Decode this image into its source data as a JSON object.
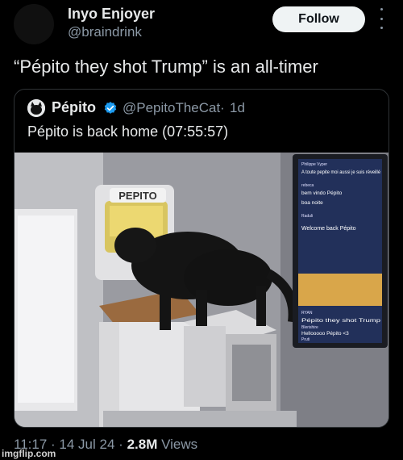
{
  "tweet": {
    "author_name": "Inyo Enjoyer",
    "author_handle": "@braindrink",
    "follow_label": "Follow",
    "text": "“Pépito they shot Trump” is an all-timer",
    "timestamp": "11:17",
    "date": "14 Jul 24",
    "views_count": "2.8M",
    "views_label": "Views",
    "separator": "·"
  },
  "quoted": {
    "author_name": "Pépito",
    "author_handle": "@PepitoTheCat",
    "age": "1d",
    "text": "Pépito is back home (07:55:57)",
    "media": {
      "flap_label": "PEPITO",
      "screen_chat": [
        {
          "user": "Philippe Vyper",
          "message": "A toute pepite moi aussi je suis réveillé"
        },
        {
          "user": "rebeca",
          "message": "bem vindo Pépito"
        },
        {
          "user": "",
          "message": "boa noite"
        },
        {
          "user": "Raduli",
          "message": "Welcome back Pépito"
        },
        {
          "user": "RYAN",
          "message": "Pépito they shot Trump"
        },
        {
          "user": "Blerishire",
          "message": "Hellooooo Pépito <3"
        },
        {
          "user": "Pruti",
          "message": ""
        }
      ]
    }
  },
  "watermark": "imgflip.com",
  "colors": {
    "background": "#000000",
    "primary_text": "#e7e9ea",
    "secondary_text": "#8b98a5",
    "border": "#2f3336",
    "verified": "#1d9bf0",
    "follow_bg": "#eff3f4"
  }
}
